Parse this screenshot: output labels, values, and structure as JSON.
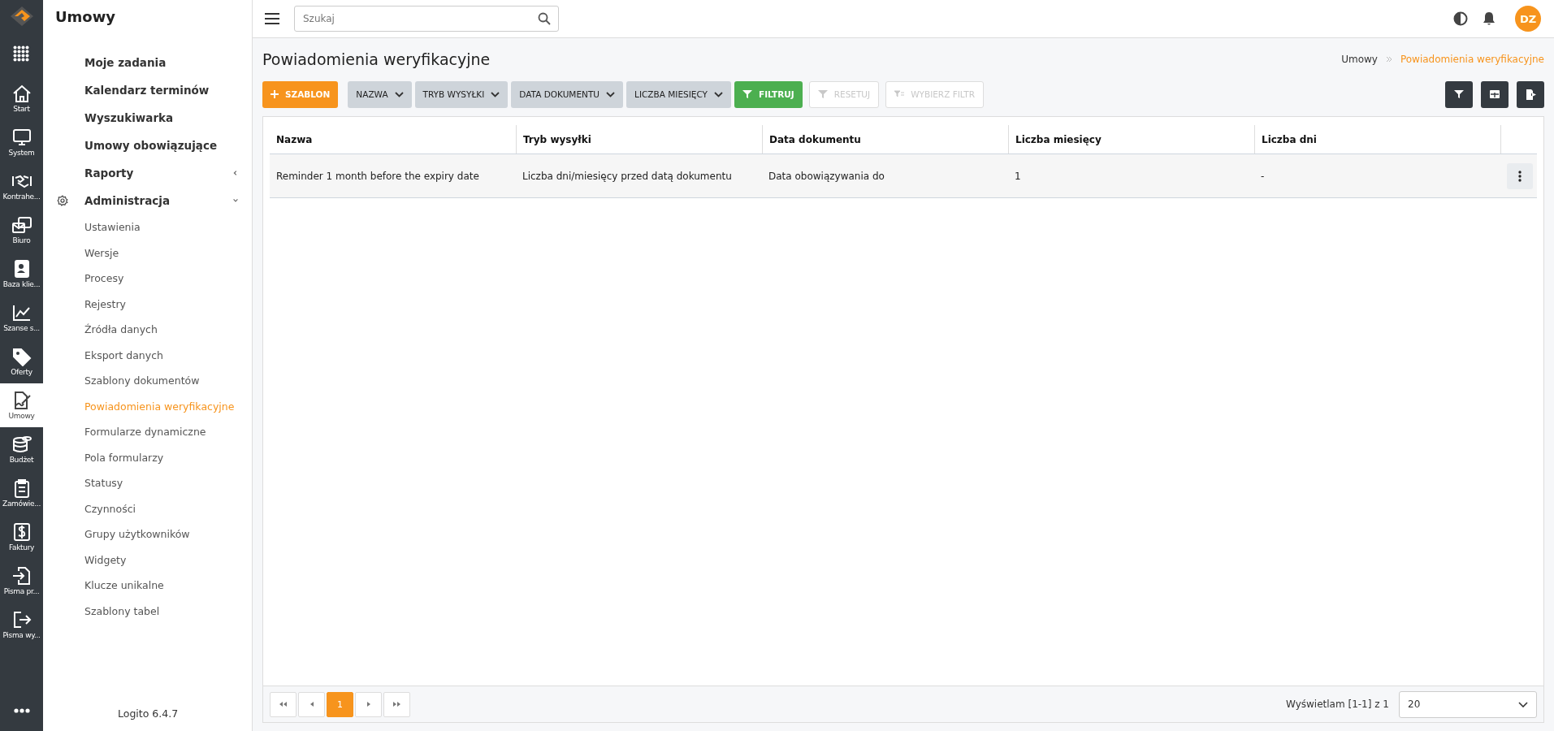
{
  "rail": [
    {
      "label": "Start",
      "selected": false
    },
    {
      "label": "System",
      "selected": false
    },
    {
      "label": "Kontrahe...",
      "selected": false
    },
    {
      "label": "Biuro",
      "selected": false
    },
    {
      "label": "Baza klie...",
      "selected": false
    },
    {
      "label": "Szanse s...",
      "selected": false
    },
    {
      "label": "Oferty",
      "selected": false
    },
    {
      "label": "Umowy",
      "selected": true
    },
    {
      "label": "Budżet",
      "selected": false
    },
    {
      "label": "Zamówie...",
      "selected": false
    },
    {
      "label": "Faktury",
      "selected": false
    },
    {
      "label": "Pisma pr...",
      "selected": false
    },
    {
      "label": "Pisma wy...",
      "selected": false
    }
  ],
  "sidebar": {
    "title": "Umowy",
    "version": "Logito 6.4.7",
    "items": [
      {
        "label": "Moje zadania",
        "kind": "link"
      },
      {
        "label": "Kalendarz terminów",
        "kind": "link"
      },
      {
        "label": "Wyszukiwarka",
        "kind": "link"
      },
      {
        "label": "Umowy obowiązujące",
        "kind": "link"
      },
      {
        "label": "Raporty",
        "kind": "group",
        "expanded": false
      },
      {
        "label": "Administracja",
        "kind": "group",
        "expanded": true,
        "children": [
          {
            "label": "Ustawienia",
            "selected": false
          },
          {
            "label": "Wersje",
            "selected": false
          },
          {
            "label": "Procesy",
            "selected": false
          },
          {
            "label": "Rejestry",
            "selected": false
          },
          {
            "label": "Źródła danych",
            "selected": false
          },
          {
            "label": "Eksport danych",
            "selected": false
          },
          {
            "label": "Szablony dokumentów",
            "selected": false
          },
          {
            "label": "Powiadomienia weryfikacyjne",
            "selected": true
          },
          {
            "label": "Formularze dynamiczne",
            "selected": false
          },
          {
            "label": "Pola formularzy",
            "selected": false
          },
          {
            "label": "Statusy",
            "selected": false
          },
          {
            "label": "Czynności",
            "selected": false
          },
          {
            "label": "Grupy użytkowników",
            "selected": false
          },
          {
            "label": "Widgety",
            "selected": false
          },
          {
            "label": "Klucze unikalne",
            "selected": false
          },
          {
            "label": "Szablony tabel",
            "selected": false
          }
        ]
      }
    ]
  },
  "topbar": {
    "search": {
      "placeholder": "Szukaj"
    },
    "avatar": "DZ"
  },
  "page": {
    "title": "Powiadomienia weryfikacyjne",
    "breadcrumb": [
      {
        "label": "Umowy",
        "selected": false
      },
      {
        "label": "Powiadomienia weryfikacyjne",
        "selected": true
      }
    ]
  },
  "toolbar": [
    {
      "kind": "add",
      "label": "SZABLON",
      "disabled": false
    },
    {
      "kind": "dropdown",
      "label": "NAZWA",
      "disabled": false
    },
    {
      "kind": "dropdown",
      "label": "TRYB WYSYŁKI",
      "disabled": false
    },
    {
      "kind": "dropdown",
      "label": "DATA DOKUMENTU",
      "disabled": false
    },
    {
      "kind": "dropdown",
      "label": "LICZBA MIESIĘCY",
      "disabled": false
    },
    {
      "kind": "filter",
      "label": "FILTRUJ",
      "disabled": false
    },
    {
      "kind": "reset",
      "label": "RESETUJ",
      "disabled": true
    },
    {
      "kind": "choose",
      "label": "WYBIERZ FILTR",
      "disabled": true
    }
  ],
  "table": {
    "columns": [
      "Nazwa",
      "Tryb wysyłki",
      "Data dokumentu",
      "Liczba miesięcy",
      "Liczba dni"
    ],
    "rows": [
      {
        "cells": [
          "Reminder 1 month before the expiry date",
          "Liczba dni/miesięcy przed datą dokumentu",
          "Data obowiązywania do",
          "1",
          "-"
        ]
      }
    ]
  },
  "pagination": {
    "pages": [
      {
        "label": "1",
        "selected": true
      }
    ],
    "summary": "Wyświetlam [1-1] z 1",
    "page_size": "20"
  }
}
